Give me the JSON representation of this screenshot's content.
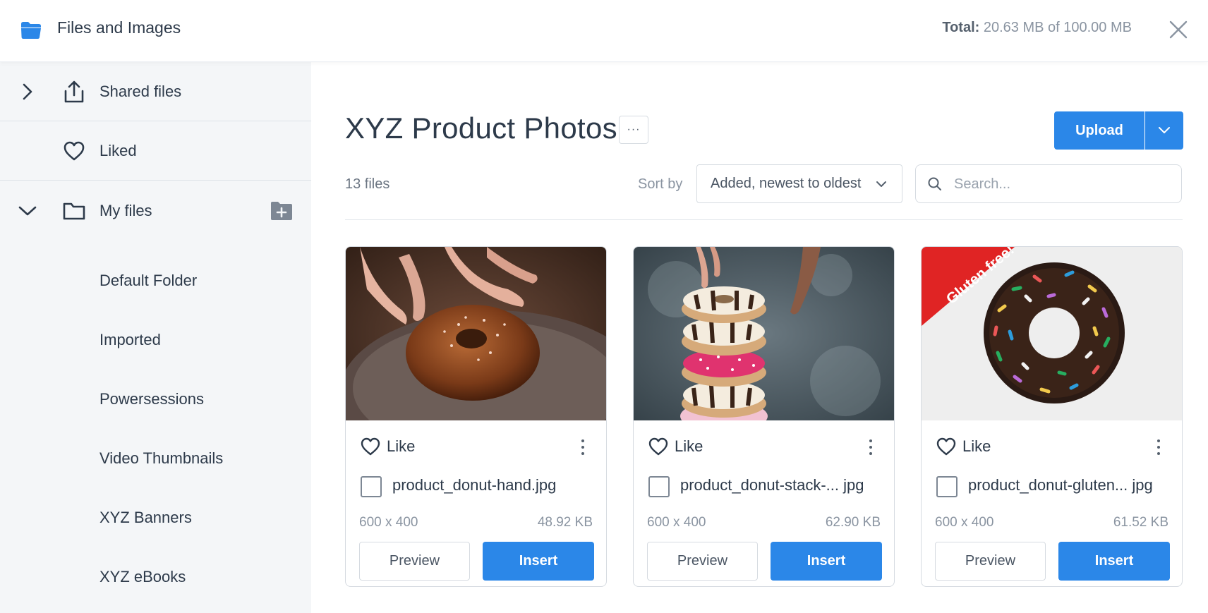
{
  "header": {
    "title": "Files and Images",
    "total_label": "Total:",
    "total_value": "20.63 MB of 100.00 MB"
  },
  "sidebar": {
    "shared_files": "Shared files",
    "liked": "Liked",
    "my_files": "My files",
    "folders": [
      "Default Folder",
      "Imported",
      "Powersessions",
      "Video Thumbnails",
      "XYZ Banners",
      "XYZ eBooks"
    ]
  },
  "main": {
    "title": "XYZ Product Photos",
    "more_label": "···",
    "upload_label": "Upload",
    "file_count": "13 files",
    "sort_label": "Sort by",
    "sort_value": "Added, newest to oldest",
    "search_placeholder": "Search...",
    "cards": [
      {
        "like_label": "Like",
        "filename": "product_donut-hand.jpg",
        "dimensions": "600 x 400",
        "size": "48.92 KB",
        "preview_label": "Preview",
        "insert_label": "Insert"
      },
      {
        "like_label": "Like",
        "filename": "product_donut-stack-... jpg",
        "dimensions": "600 x 400",
        "size": "62.90 KB",
        "preview_label": "Preview",
        "insert_label": "Insert"
      },
      {
        "like_label": "Like",
        "filename": "product_donut-gluten... jpg",
        "dimensions": "600 x 400",
        "size": "61.52 KB",
        "preview_label": "Preview",
        "insert_label": "Insert",
        "ribbon": "Gluten free!"
      }
    ]
  },
  "colors": {
    "accent": "#2b87e8",
    "sidebar_bg": "#f4f6f8",
    "text": "#2d3a4a",
    "muted": "#8a94a1"
  }
}
